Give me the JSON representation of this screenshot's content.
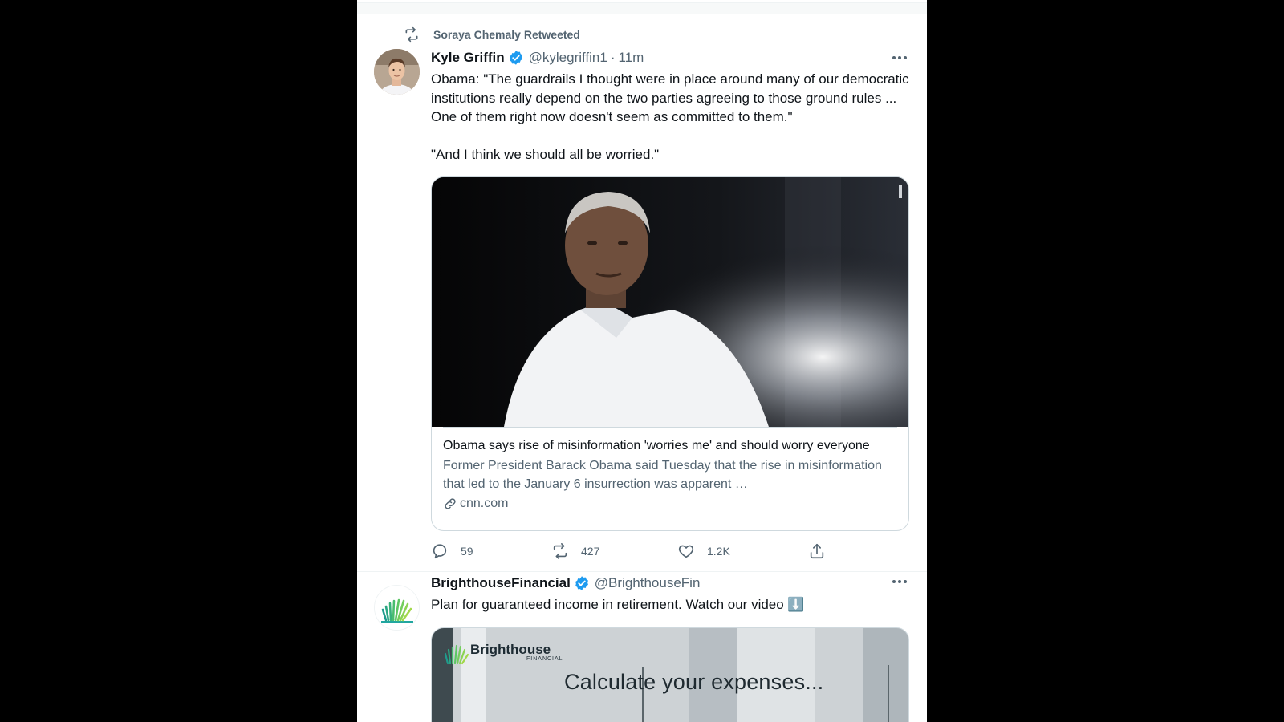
{
  "tweet1": {
    "retweeted_by": "Soraya Chemaly Retweeted",
    "author_name": "Kyle Griffin",
    "author_handle": "@kylegriffin1",
    "time": "11m",
    "text": "Obama: \"The guardrails I thought were in place around many of our democratic institutions really depend on the two parties agreeing to those ground rules ... One of them right now doesn't seem as committed to them.\"\n\n\"And I think we should all be worried.\"",
    "card": {
      "title": "Obama says rise of misinformation 'worries me' and should worry everyone",
      "description": "Former President Barack Obama said Tuesday that the rise in misinformation that led to the January 6 insurrection was apparent …",
      "domain": "cnn.com"
    },
    "stats": {
      "replies": "59",
      "retweets": "427",
      "likes": "1.2K"
    }
  },
  "tweet2": {
    "author_name": "BrighthouseFinancial",
    "author_handle": "@BrighthouseFin",
    "text": "Plan for guaranteed income in retirement. Watch our video ⬇️",
    "video": {
      "brand": "Brighthouse",
      "brand_sub": "FINANCIAL",
      "headline": "Calculate your expenses..."
    }
  },
  "colors": {
    "text_primary": "#0f1419",
    "text_secondary": "#536471",
    "verified_blue": "#1d9bf0",
    "border": "#cfd9de",
    "outer_background": "#000000"
  },
  "icons": [
    "retweet-icon",
    "verified-badge-icon",
    "more-icon",
    "reply-icon",
    "like-icon",
    "share-icon",
    "link-icon"
  ]
}
